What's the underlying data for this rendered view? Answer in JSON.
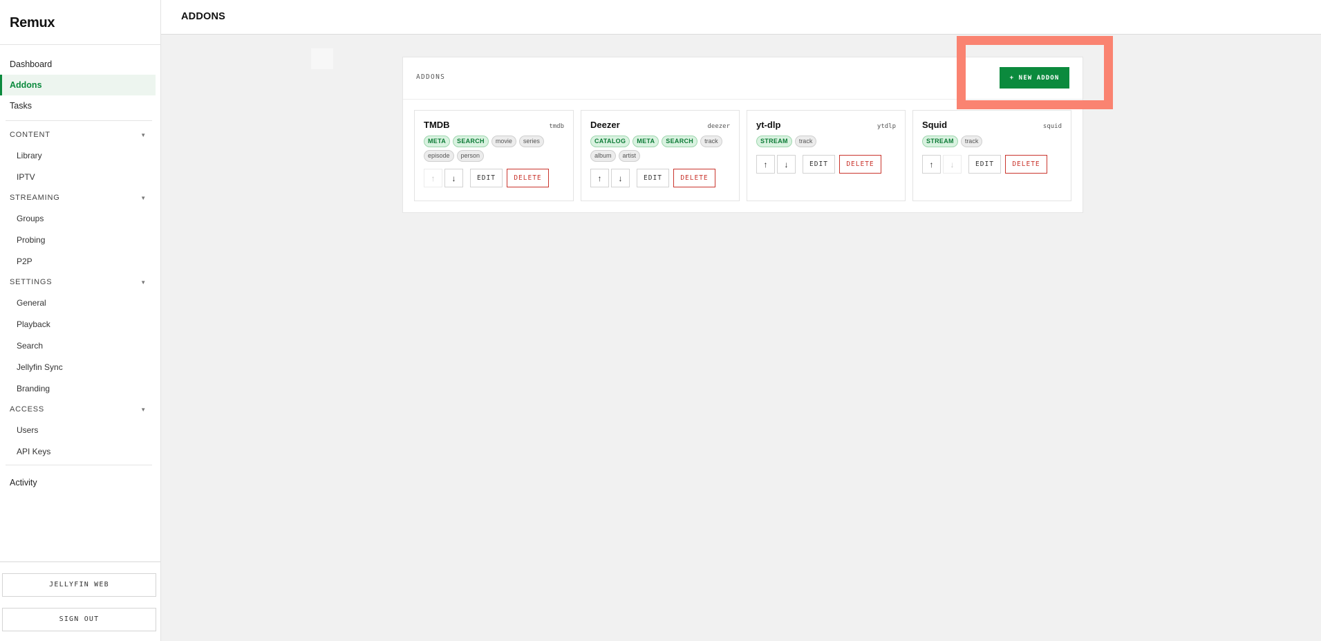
{
  "brand": "Remux",
  "header": {
    "title": "ADDONS"
  },
  "sidebar": {
    "top_items": [
      {
        "label": "Dashboard",
        "active": false
      },
      {
        "label": "Addons",
        "active": true
      },
      {
        "label": "Tasks",
        "active": false
      }
    ],
    "sections": [
      {
        "title": "CONTENT",
        "items": [
          "Library",
          "IPTV"
        ]
      },
      {
        "title": "STREAMING",
        "items": [
          "Groups",
          "Probing",
          "P2P"
        ]
      },
      {
        "title": "SETTINGS",
        "items": [
          "General",
          "Playback",
          "Search",
          "Jellyfin Sync",
          "Branding"
        ]
      },
      {
        "title": "ACCESS",
        "items": [
          "Users",
          "API Keys"
        ]
      }
    ],
    "bottom_item": "Activity",
    "buttons": {
      "jellyfin": "JELLYFIN WEB",
      "signout": "SIGN OUT"
    }
  },
  "panel": {
    "label": "ADDONS",
    "new_button": "+ NEW ADDON"
  },
  "addons": [
    {
      "name": "TMDB",
      "id": "tmdb",
      "caps": [
        "META",
        "SEARCH"
      ],
      "types": [
        "movie",
        "series",
        "episode",
        "person"
      ],
      "up_disabled": true,
      "down_disabled": false
    },
    {
      "name": "Deezer",
      "id": "deezer",
      "caps": [
        "CATALOG",
        "META",
        "SEARCH"
      ],
      "types": [
        "track",
        "album",
        "artist"
      ],
      "up_disabled": false,
      "down_disabled": false
    },
    {
      "name": "yt-dlp",
      "id": "ytdlp",
      "caps": [
        "STREAM"
      ],
      "types": [
        "track"
      ],
      "up_disabled": false,
      "down_disabled": false
    },
    {
      "name": "Squid",
      "id": "squid",
      "caps": [
        "STREAM"
      ],
      "types": [
        "track"
      ],
      "up_disabled": false,
      "down_disabled": true
    }
  ],
  "card_actions": {
    "edit": "EDIT",
    "delete": "DELETE",
    "up": "↑",
    "down": "↓"
  },
  "colors": {
    "accent": "#0b8a3d",
    "danger": "#c9342c",
    "highlight": "#fa8371"
  }
}
